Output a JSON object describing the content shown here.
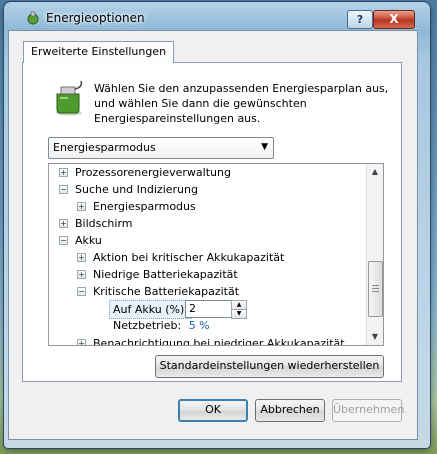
{
  "window": {
    "title": "Energieoptionen",
    "help_label": "?",
    "close_label": "X"
  },
  "tab": {
    "label": "Erweiterte Einstellungen"
  },
  "intro_text": "Wählen Sie den anzupassenden Energiesparplan aus, und wählen Sie dann die gewünschten Energiespareinstellungen aus.",
  "plan_select": {
    "value": "Energiesparmodus"
  },
  "tree": {
    "items": [
      {
        "label": "Prozessorenergieverwaltung",
        "expander": "+"
      },
      {
        "label": "Suche und Indizierung",
        "expander": "−"
      },
      {
        "label": "Energiesparmodus",
        "expander": "+"
      },
      {
        "label": "Bildschirm",
        "expander": "+"
      },
      {
        "label": "Akku",
        "expander": "−"
      },
      {
        "label": "Aktion bei kritischer Akkukapazität",
        "expander": "+"
      },
      {
        "label": "Niedrige Batteriekapazität",
        "expander": "+"
      },
      {
        "label": "Kritische Batteriekapazität",
        "expander": "−"
      },
      {
        "label": "Benachrichtigung bei niedriger Akkukapazität",
        "expander": "+"
      }
    ],
    "setting_battery_label": "Auf Akku (%):",
    "setting_battery_value": "2",
    "setting_plugged_label": "Netzbetrieb:",
    "setting_plugged_value": "5 %"
  },
  "buttons": {
    "restore_defaults": "Standardeinstellungen wiederherstellen",
    "ok": "OK",
    "cancel": "Abbrechen",
    "apply": "Übernehmen"
  },
  "colors": {
    "link_blue": "#1a5fb4",
    "selection": "#cce4f7"
  }
}
